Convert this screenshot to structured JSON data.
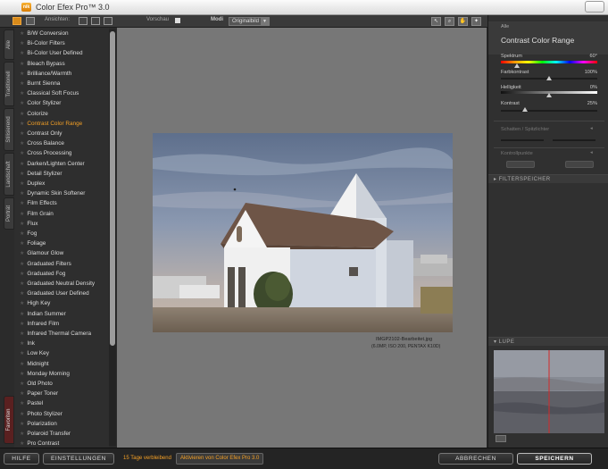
{
  "window": {
    "title": "Color Efex Pro™ 3.0",
    "logo_text": "nik"
  },
  "toolbar": {
    "views_label": "Ansichten:",
    "preview_label": "Vorschau",
    "mode_label": "Modi",
    "mode_value": "Originalbild"
  },
  "categories": [
    "Alle",
    "Traditionell",
    "Stilisierend",
    "Landschaft",
    "Porträt",
    "Favoriten"
  ],
  "filters": [
    "B/W Conversion",
    "Bi-Color Filters",
    "Bi-Color User Defined",
    "Bleach Bypass",
    "Brilliance/Warmth",
    "Burnt Sienna",
    "Classical Soft Focus",
    "Color Stylizer",
    "Colorize",
    "Contrast Color Range",
    "Contrast Only",
    "Cross Balance",
    "Cross Processing",
    "Darken/Lighten Center",
    "Detail Stylizer",
    "Duplex",
    "Dynamic Skin Softener",
    "Film Effects",
    "Film Grain",
    "Flux",
    "Fog",
    "Foliage",
    "Glamour Glow",
    "Graduated Filters",
    "Graduated Fog",
    "Graduated Neutral Density",
    "Graduated User Defined",
    "High Key",
    "Indian Summer",
    "Infrared Film",
    "Infrared Thermal Camera",
    "Ink",
    "Low Key",
    "Midnight",
    "Monday Morning",
    "Old Photo",
    "Paper Toner",
    "Pastel",
    "Photo Stylizer",
    "Polarization",
    "Polaroid Transfer",
    "Pro Contrast"
  ],
  "active_filter_index": 9,
  "image": {
    "filename": "IMGP2102-Bearbeitet.jpg",
    "info": "(6.0MP, ISO 200, PENTAX K10D)"
  },
  "panel": {
    "category": "Alle",
    "title": "Contrast Color Range",
    "sliders": [
      {
        "label": "Spektrum",
        "value": "60°",
        "fraction": 0.17
      },
      {
        "label": "Farbkontrast",
        "value": "100%",
        "fraction": 0.5
      },
      {
        "label": "Helligkeit",
        "value": "0%",
        "fraction": 0.5
      },
      {
        "label": "Kontrast",
        "value": "25%",
        "fraction": 0.25
      }
    ],
    "shadows_label": "Schatten / Spitzlichter",
    "controlpoints_label": "Kontrollpunkte",
    "filtermemory_label": "FILTERSPEICHER",
    "loupe_label": "LUPE"
  },
  "bottom": {
    "help": "HILFE",
    "settings": "EINSTELLUNGEN",
    "trial": "15 Tage verbleibend",
    "activate": "Aktivieren von Color Efex Pro 3.0",
    "cancel": "ABBRECHEN",
    "save": "SPEICHERN"
  },
  "colors": {
    "accent": "#f4a026",
    "canvas_bg": "#777777",
    "panel_bg": "#303030"
  }
}
